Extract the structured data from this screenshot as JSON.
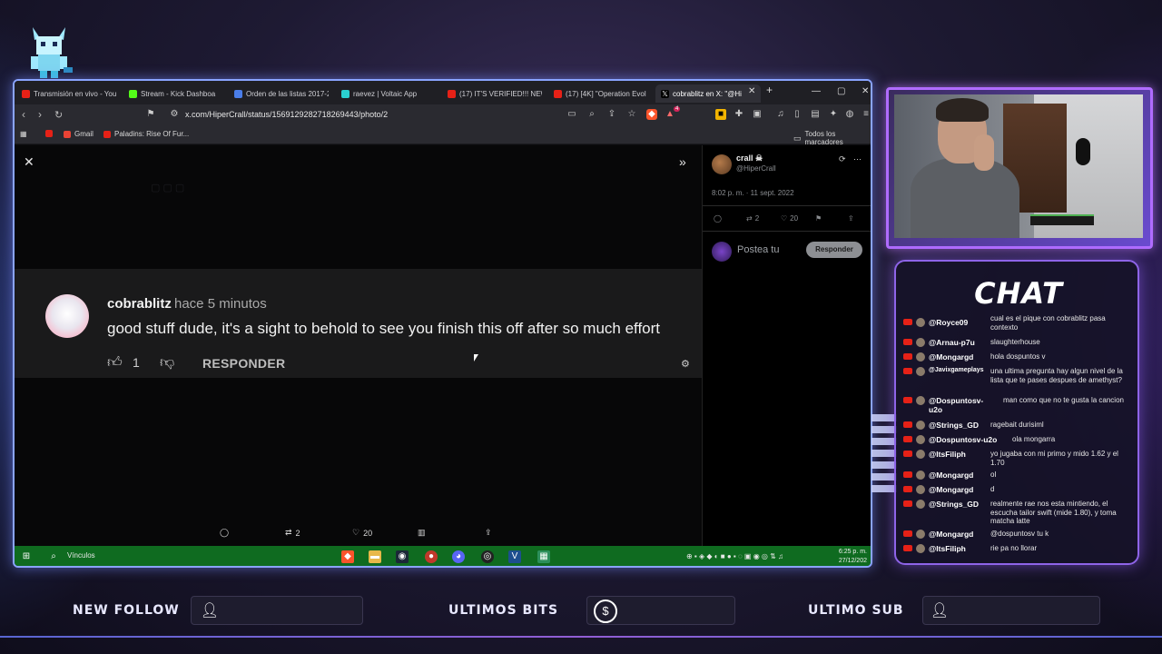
{
  "browser": {
    "tabs": [
      {
        "label": "Transmisión en vivo - You",
        "color": "#e62117"
      },
      {
        "label": "Stream - Kick Dashboa",
        "color": "#53fc18"
      },
      {
        "label": "Orden de las listas 2017-2",
        "color": "#4a7de8"
      },
      {
        "label": "raevez | Voltaic App",
        "color": "#2ad0d0"
      },
      {
        "label": "(17) IT'S VERIFIED!!! NEW",
        "color": "#e62117"
      },
      {
        "label": "(17) [4K] \"Operation Evol",
        "color": "#e62117"
      },
      {
        "label": "cobrablitz en X: \"@Hi",
        "color": "#ffffff"
      }
    ],
    "new_tab": "+",
    "url": "x.com/HiperCrall/status/1569129282718269443/photo/2",
    "bookmarks": [
      {
        "label": "Gmail",
        "color": "#ea4335"
      },
      {
        "label": "Paladins: Rise Of Fur...",
        "color": "#e62117"
      }
    ],
    "all_bookmarks": "Todos los marcadores",
    "brave_badge": "4"
  },
  "comment": {
    "username": "cobrablitz",
    "time": "hace 5 minutos",
    "text": "good stuff dude, it's a sight to behold to see you finish this off after so much effort",
    "likes": "1",
    "reply_label": "RESPONDER"
  },
  "action_bar": {
    "retweets": "2",
    "likes": "20"
  },
  "tweet": {
    "name": "crall ☠",
    "handle": "@HiperCrall",
    "timestamp": "8:02 p. m. · 11 sept. 2022",
    "retweets": "2",
    "likes": "20",
    "post_placeholder": "Postea tu",
    "reply_button": "Responder"
  },
  "taskbar": {
    "search_label": "Vínculos",
    "time": "6:25 p. m.",
    "date": "27/12/202"
  },
  "chat": {
    "title": "CHAT",
    "messages": [
      {
        "user": "@Royce09",
        "text": "cual es el pique con cobrablitz pasa contexto"
      },
      {
        "user": "@Arnau-p7u",
        "text": "slaughterhouse"
      },
      {
        "user": "@Mongargd",
        "text": "hola dospuntos v"
      },
      {
        "user": "@Javixgameplays",
        "text": "una ultima pregunta hay algun nivel de la lista que te pases despues de amethyst?"
      },
      {
        "user": "@Dospuntosv-u2o",
        "text": "man como que no te gusta la cancion"
      },
      {
        "user": "@Strings_GD",
        "text": "ragebait durisiml"
      },
      {
        "user": "@Dospuntosv-u2o",
        "text": "ola mongarra"
      },
      {
        "user": "@ItsFiliph",
        "text": "yo jugaba con mi primo y mido 1.62 y el 1.70"
      },
      {
        "user": "@Mongargd",
        "text": "ol"
      },
      {
        "user": "@Mongargd",
        "text": "d"
      },
      {
        "user": "@Strings_GD",
        "text": "realmente rae nos esta mintiendo, el escucha tailor swift (mide 1.80), y toma matcha latte"
      },
      {
        "user": "@Mongargd",
        "text": "@dospuntosv tu k"
      },
      {
        "user": "@ItsFiliph",
        "text": "rie pa no llorar"
      }
    ]
  },
  "alerts": {
    "new_follow": "NEW FOLLOW",
    "ultimos_bits": "ULTIMOS BITS",
    "ultimo_sub": "ULTIMO SUB"
  }
}
